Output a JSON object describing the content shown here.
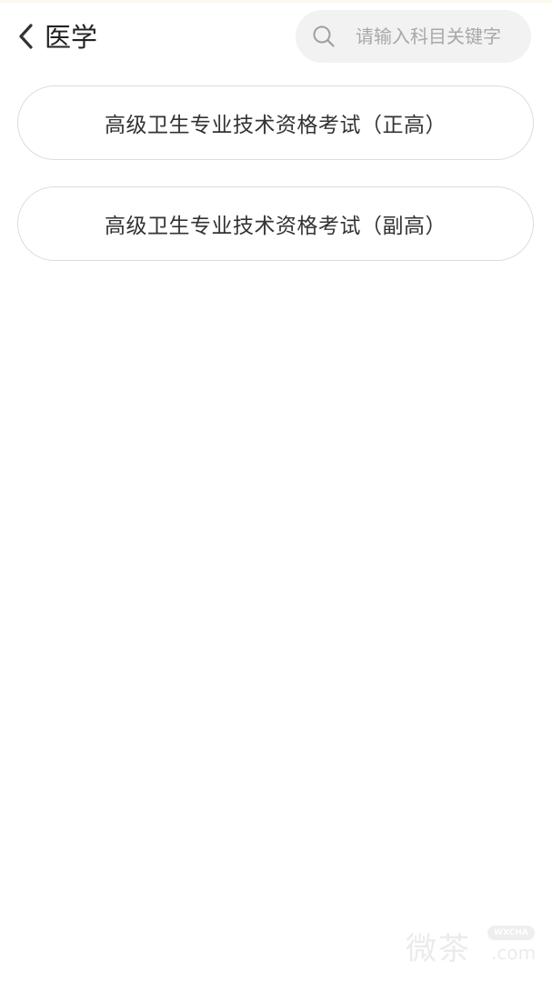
{
  "header": {
    "title": "医学",
    "back_icon": "chevron-left-icon"
  },
  "search": {
    "placeholder": "请输入科目关键字",
    "value": "",
    "icon": "search-icon"
  },
  "exams": [
    {
      "label": "高级卫生专业技术资格考试（正高）"
    },
    {
      "label": "高级卫生专业技术资格考试（副高）"
    }
  ],
  "watermark": {
    "text": "微茶",
    "badge": "WXCHA",
    "suffix": ".com"
  },
  "colors": {
    "background": "#ffffff",
    "search_bg": "#f2f2f2",
    "card_border": "#dcdcdc",
    "text": "#333333",
    "placeholder": "#a8a8a8"
  }
}
